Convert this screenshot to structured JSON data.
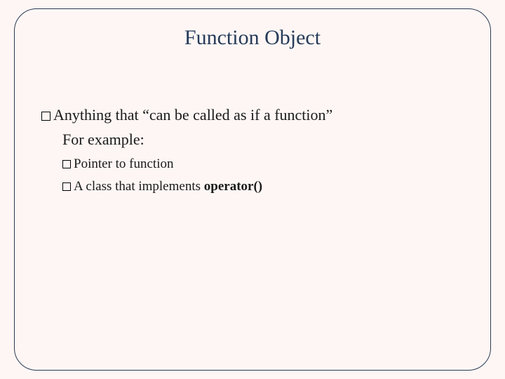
{
  "title": "Function Object",
  "point1_prefix": "Anything that ",
  "point1_quote": "“can be called as if a function”",
  "example_label": "For example:",
  "sub1": "Pointer to function",
  "sub2_prefix": "A class that implements ",
  "sub2_bold": "operator()"
}
